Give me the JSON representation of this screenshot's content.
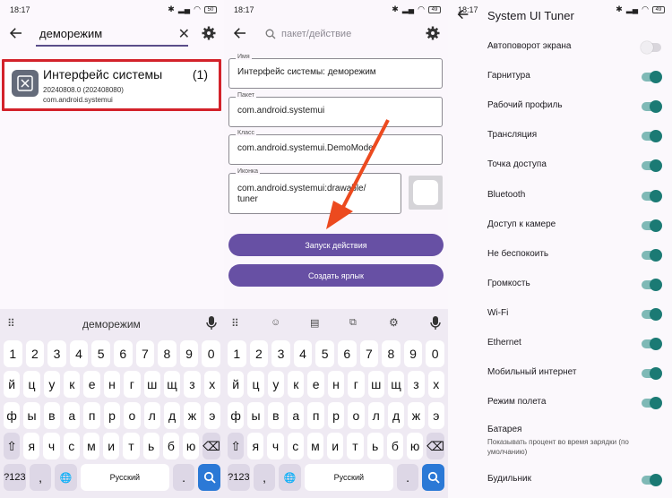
{
  "status": {
    "time": "18:17",
    "battery1": "50",
    "battery2": "49",
    "battery3": "49"
  },
  "p1": {
    "search_value": "деморежим",
    "result": {
      "title": "Интерфейс системы",
      "count": "(1)",
      "version": "20240808.0 (202408080)",
      "package": "com.android.systemui"
    },
    "kbd_suggest": "деморежим"
  },
  "p2": {
    "search_placeholder": "пакет/действие",
    "fields": [
      {
        "label": "Имя",
        "value": "Интерфейс системы: деморежим"
      },
      {
        "label": "Пакет",
        "value": "com.android.systemui"
      },
      {
        "label": "Класс",
        "value": "com.android.systemui.DemoMode"
      },
      {
        "label": "Иконка",
        "value1": "com.android.systemui:drawable/",
        "value2": "tuner"
      }
    ],
    "launch_label": "Запуск действия",
    "shortcut_label": "Создать ярлык"
  },
  "keyboard": {
    "row1": [
      "1",
      "2",
      "3",
      "4",
      "5",
      "6",
      "7",
      "8",
      "9",
      "0"
    ],
    "row2": [
      "й",
      "ц",
      "у",
      "к",
      "е",
      "н",
      "г",
      "ш",
      "щ",
      "з",
      "х"
    ],
    "row3": [
      "ф",
      "ы",
      "в",
      "а",
      "п",
      "р",
      "о",
      "л",
      "д",
      "ж",
      "э"
    ],
    "row4": [
      "я",
      "ч",
      "с",
      "м",
      "и",
      "т",
      "ь",
      "б",
      "ю"
    ],
    "sym": "?123",
    "comma": ",",
    "space": "Русский",
    "period": "."
  },
  "tuner": {
    "title": "System UI Tuner",
    "items": [
      {
        "label": "Автоповорот экрана",
        "on": false
      },
      {
        "label": "Гарнитура",
        "on": true
      },
      {
        "label": "Рабочий профиль",
        "on": true
      },
      {
        "label": "Трансляция",
        "on": true
      },
      {
        "label": "Точка доступа",
        "on": true
      },
      {
        "label": "Bluetooth",
        "on": true
      },
      {
        "label": "Доступ к камере",
        "on": true
      },
      {
        "label": "Не беспокоить",
        "on": true
      },
      {
        "label": "Громкость",
        "on": true
      },
      {
        "label": "Wi-Fi",
        "on": true
      },
      {
        "label": "Ethernet",
        "on": true
      },
      {
        "label": "Мобильный интернет",
        "on": true
      },
      {
        "label": "Режим полета",
        "on": true
      }
    ],
    "battery_label": "Батарея",
    "battery_sub": "Показывать процент во время зарядки (по умолчанию)",
    "alarm_label": "Будильник",
    "alarm_on": true
  },
  "colors": {
    "accent": "#6750a4",
    "toggle_on": "#1b7a74",
    "highlight": "#d3222a",
    "arrow": "#ec4a1f",
    "send": "#2b79d6"
  }
}
